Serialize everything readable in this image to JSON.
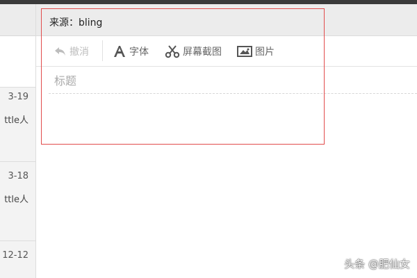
{
  "compose": {
    "source_label": "来源：bling",
    "subject_placeholder": "标题"
  },
  "toolbar": {
    "undo_label": "撤消",
    "font_label": "字体",
    "screenshot_label": "屏幕截图",
    "image_label": "图片"
  },
  "mail_list": {
    "items": [
      {
        "date": "3-19",
        "sender": "ttle人"
      },
      {
        "date": "3-18",
        "sender": "ttle人"
      },
      {
        "date": "12-12",
        "sender": ""
      }
    ]
  },
  "watermark": "头条 @肥仙女",
  "icons": [
    "undo-icon",
    "font-icon",
    "scissors-icon",
    "image-icon"
  ],
  "colors": {
    "highlight_box": "#e14b4b",
    "header_bg": "#ececec"
  }
}
